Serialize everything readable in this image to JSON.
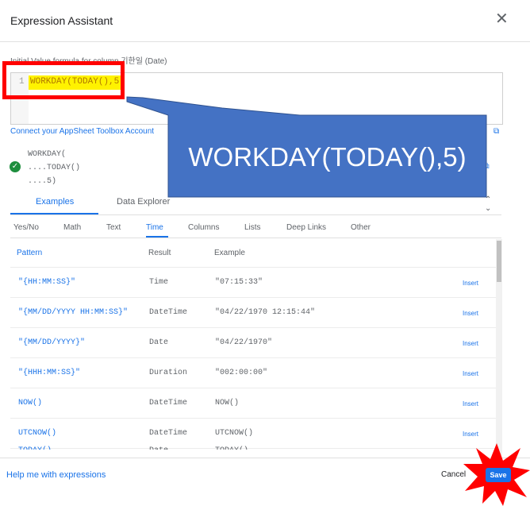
{
  "dialog": {
    "title": "Expression Assistant",
    "close_icon": "close-icon"
  },
  "editor": {
    "label": "Initial Value formula for column 기한일 (Date)",
    "line_number": "1",
    "code": "WORKDAY(TODAY(),5)"
  },
  "links": {
    "connect": "Connect your AppSheet Toolbox Account"
  },
  "parse_tree": [
    "WORKDAY(",
    "....TODAY()",
    "....5)"
  ],
  "main_tabs": [
    {
      "label": "Examples",
      "active": true
    },
    {
      "label": "Data Explorer",
      "active": false
    }
  ],
  "sub_tabs": [
    "Yes/No",
    "Math",
    "Text",
    "Time",
    "Columns",
    "Lists",
    "Deep Links",
    "Other"
  ],
  "table": {
    "headers": {
      "pattern": "Pattern",
      "result": "Result",
      "example": "Example"
    },
    "insert_label": "Insert",
    "rows": [
      {
        "pattern": "\"{HH:MM:SS}\"",
        "result": "Time",
        "example": "\"07:15:33\""
      },
      {
        "pattern": "\"{MM/DD/YYYY HH:MM:SS}\"",
        "result": "DateTime",
        "example": "\"04/22/1970 12:15:44\""
      },
      {
        "pattern": "\"{MM/DD/YYYY}\"",
        "result": "Date",
        "example": "\"04/22/1970\""
      },
      {
        "pattern": "\"{HHH:MM:SS}\"",
        "result": "Duration",
        "example": "\"002:00:00\""
      },
      {
        "pattern": "NOW()",
        "result": "DateTime",
        "example": "NOW()"
      },
      {
        "pattern": "UTCNOW()",
        "result": "DateTime",
        "example": "UTCNOW()"
      },
      {
        "pattern": "TODAY()",
        "result": "Date",
        "example": "TODAY()"
      }
    ]
  },
  "footer": {
    "help": "Help me with expressions",
    "cancel": "Cancel",
    "save": "Save"
  },
  "annotation": {
    "callout_text": "WORKDAY(TODAY(),5)",
    "highlight_color": "#fff200",
    "box_color": "#ff0000",
    "callout_color": "#4472c4",
    "burst_color": "#ff0000"
  },
  "colors": {
    "accent": "#1a73e8",
    "success": "#1e8e3e"
  }
}
